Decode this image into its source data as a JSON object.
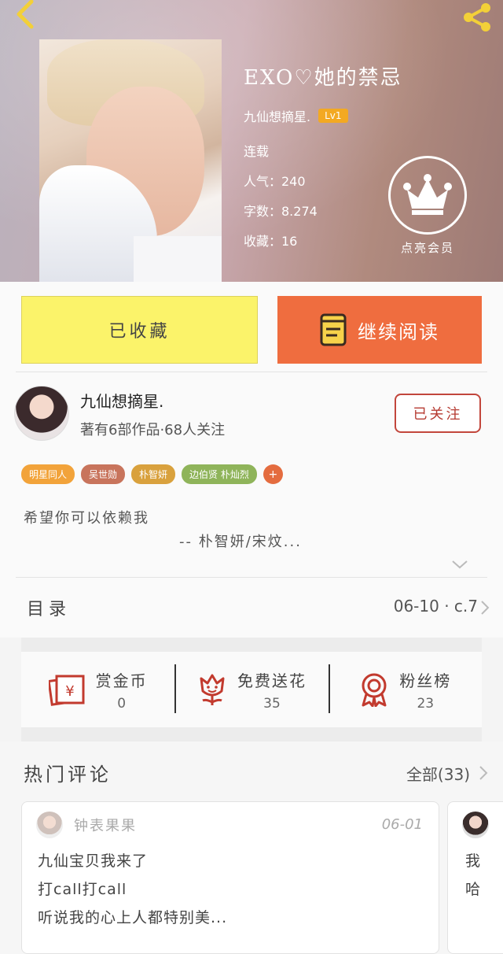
{
  "book": {
    "title": "EXO♡她的禁忌",
    "author": "九仙想摘星.",
    "level": "Lv1",
    "status": "连载",
    "popularity": "人气：240",
    "word_count": "字数：8.274",
    "favorites": "收藏：16",
    "vip_label": "点亮会员"
  },
  "actions": {
    "collected_label": "已收藏",
    "continue_label": "继续阅读"
  },
  "author_card": {
    "name": "九仙想摘星.",
    "stats": "著有6部作品·68人关注",
    "follow_label": "已关注",
    "tags": [
      {
        "label": "明星同人",
        "color": "#f2a33a"
      },
      {
        "label": "吴世勋",
        "color": "#c8745c"
      },
      {
        "label": "朴智妍",
        "color": "#d9a13d"
      },
      {
        "label": "边伯贤  朴灿烈",
        "color": "#8fb45a"
      }
    ],
    "tag_more": "+",
    "intro_line1": "希望你可以依赖我",
    "intro_line2": "--   朴智妍/宋炆..."
  },
  "catalog": {
    "title": "目录",
    "latest": "06-10 · c.7"
  },
  "rewards": [
    {
      "label": "赏金币",
      "count": "0",
      "icon": "red-envelope-icon"
    },
    {
      "label": "免费送花",
      "count": "35",
      "icon": "flower-icon"
    },
    {
      "label": "粉丝榜",
      "count": "23",
      "icon": "medal-icon"
    }
  ],
  "comments": {
    "title": "热门评论",
    "all_label": "全部(33)",
    "items": [
      {
        "user": "钟表果果",
        "date": "06-01",
        "lines": [
          "九仙宝贝我来了",
          "打call打call",
          "听说我的心上人都特别美..."
        ]
      },
      {
        "lines": [
          "我",
          "哈"
        ]
      }
    ]
  },
  "colors": {
    "accent_orange": "#ef6d3f",
    "collect_yellow": "#fbf36a",
    "follow_red": "#c2463c"
  }
}
